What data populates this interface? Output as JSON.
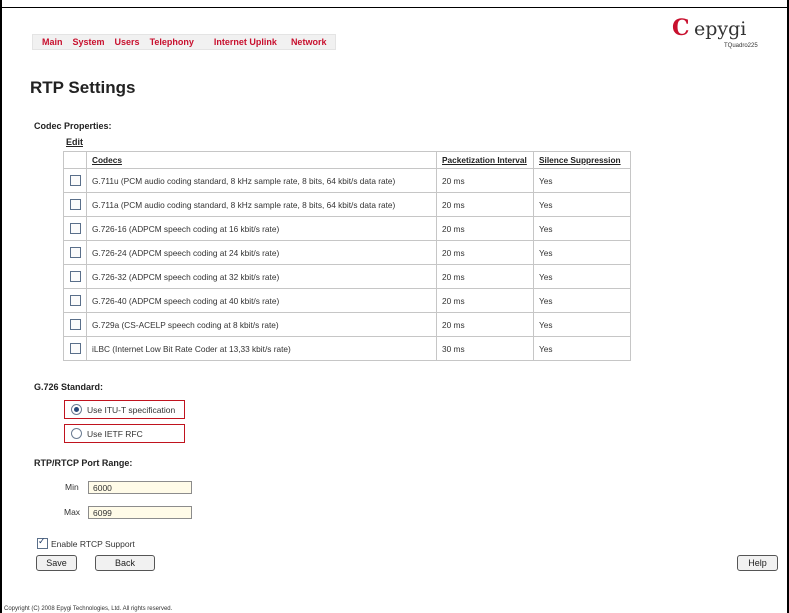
{
  "nav": {
    "items": [
      "Main",
      "System",
      "Users",
      "Telephony",
      "Internet Uplink",
      "Network"
    ]
  },
  "brand": {
    "logo_text": "epygi",
    "model": "TQuadro225",
    "accent_color": "#c8102e"
  },
  "page": {
    "title": "RTP Settings"
  },
  "codec_properties": {
    "label": "Codec Properties:",
    "edit_link": "Edit",
    "headers": [
      "Codecs",
      "Packetization Interval",
      "Silence Suppression"
    ],
    "rows": [
      {
        "codec": "G.711u (PCM audio coding standard, 8 kHz sample rate, 8 bits, 64 kbit/s data rate)",
        "interval": "20 ms",
        "silence": "Yes",
        "checked": false
      },
      {
        "codec": "G.711a (PCM audio coding standard, 8 kHz sample rate, 8 bits, 64 kbit/s data rate)",
        "interval": "20 ms",
        "silence": "Yes",
        "checked": false
      },
      {
        "codec": "G.726-16 (ADPCM speech coding at 16 kbit/s rate)",
        "interval": "20 ms",
        "silence": "Yes",
        "checked": false
      },
      {
        "codec": "G.726-24 (ADPCM speech coding at 24 kbit/s rate)",
        "interval": "20 ms",
        "silence": "Yes",
        "checked": false
      },
      {
        "codec": "G.726-32 (ADPCM speech coding at 32 kbit/s rate)",
        "interval": "20 ms",
        "silence": "Yes",
        "checked": false
      },
      {
        "codec": "G.726-40 (ADPCM speech coding at 40 kbit/s rate)",
        "interval": "20 ms",
        "silence": "Yes",
        "checked": false
      },
      {
        "codec": "G.729a (CS-ACELP speech coding at 8 kbit/s rate)",
        "interval": "20 ms",
        "silence": "Yes",
        "checked": false
      },
      {
        "codec": "iLBC (Internet Low Bit Rate Coder at 13,33 kbit/s rate)",
        "interval": "30 ms",
        "silence": "Yes",
        "checked": false
      }
    ]
  },
  "g726": {
    "label": "G.726 Standard:",
    "options": [
      {
        "label": "Use ITU-T specification",
        "selected": true
      },
      {
        "label": "Use IETF RFC",
        "selected": false
      }
    ]
  },
  "port_range": {
    "label": "RTP/RTCP Port Range:",
    "min_label": "Min",
    "min_value": "6000",
    "max_label": "Max",
    "max_value": "6099"
  },
  "rtcp": {
    "label": "Enable RTCP Support",
    "checked": true
  },
  "buttons": {
    "save": "Save",
    "back": "Back",
    "help": "Help"
  },
  "footer": {
    "copyright": "Copyright (C) 2008 Epygi Technologies, Ltd. All rights reserved."
  }
}
